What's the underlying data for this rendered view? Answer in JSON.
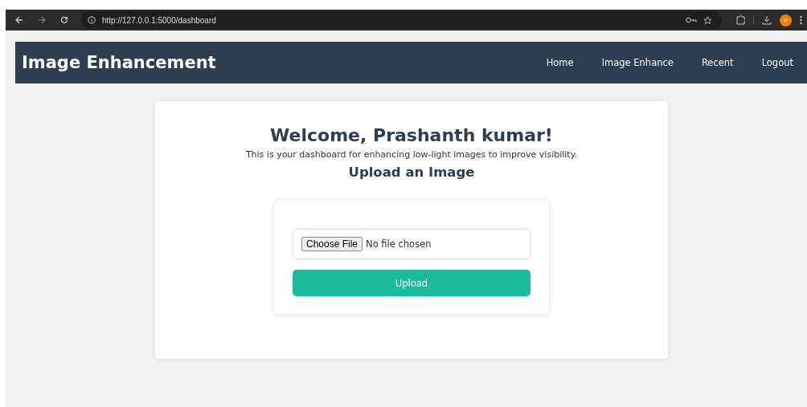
{
  "browser": {
    "url": "http://127.0.0.1:5000/dashboard",
    "avatar": "P"
  },
  "navbar": {
    "brand": "Image Enhancement",
    "links": [
      "Home",
      "Image Enhance",
      "Recent",
      "Logout"
    ]
  },
  "welcome": {
    "title": "Welcome, Prashanth kumar!",
    "subtitle": "This is your dashboard for enhancing low-light images to improve visibility.",
    "section": "Upload an Image"
  },
  "upload": {
    "choose_button": "Choose File",
    "file_status": "No file chosen",
    "submit": "Upload"
  }
}
